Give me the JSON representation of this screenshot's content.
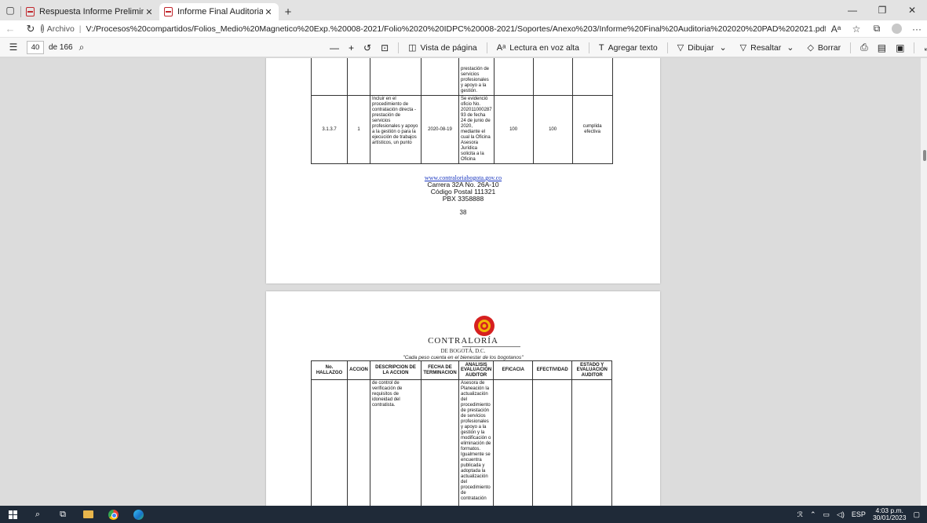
{
  "browser": {
    "tabs": [
      {
        "title": "Respuesta Informe Preliminar.pd",
        "active": false
      },
      {
        "title": "Informe Final Auditoria 2020 PAD",
        "active": true
      }
    ],
    "address": {
      "label": "Archivo",
      "url": "V:/Procesos%20compartidos/Folios_Medio%20Magnetico%20Exp.%20008-2021/Folio%2020%20IDPC%20008-2021/Soportes/Anexo%203/Informe%20Final%20Auditoria%202020%20PAD%202021.pdf"
    }
  },
  "pdf_toolbar": {
    "page_current": "40",
    "page_total": "de 166",
    "tools": {
      "zoom_out": "—",
      "zoom_in": "+",
      "page_view": "Vista de página",
      "read_aloud": "Lectura en voz alta",
      "add_text": "Agregar texto",
      "draw": "Dibujar",
      "highlight": "Resaltar",
      "erase": "Borrar"
    }
  },
  "page1": {
    "cont_row": {
      "analysis": "prestación de servicios profesionales y apoyo a la gestión."
    },
    "row": {
      "hallazgo": "3.1.3.7",
      "accion": "1",
      "descripcion": "Incluir en el procedimiento de contratación directa - prestación de servicios profesionales y apoyo a la gestión o para la ejecución de trabajos artísticos, un punto",
      "fecha": "2020-08-19",
      "analisis": "Se evidenció oficio No. 202011000287 93 de fecha 24 de junio de 2020, mediante el cual la Oficina Asesora Jurídica solicita a la Oficina",
      "eficacia": "100",
      "efectividad": "100",
      "estado": "cumplida efectiva"
    },
    "footer": {
      "website": "www.contraloriabogota.gov.co",
      "address": "Carrera 32A No. 26A-10",
      "postal": "Código Postal 111321",
      "phone": "PBX 3358888",
      "page_number": "38"
    }
  },
  "page2": {
    "logo": {
      "name": "CONTRALORÍA",
      "sub": "DE BOGOTÁ, D.C.",
      "motto": "\"Cada peso cuenta en el bienestar de los bogotanos\""
    },
    "headers": {
      "hallazgo": "No. HALLAZGO",
      "accion": "ACCION",
      "descripcion": "DESCRIPCION DE LA ACCION",
      "fecha": "FECHA DE TERMINACION",
      "analisis": "ANALISIS EVALUACIÓN AUDITOR",
      "eficacia": "EFICACIA",
      "efectividad": "EFECTIVIDAD",
      "estado": "ESTADO Y EVALUACIÓN AUDITOR"
    },
    "row": {
      "descripcion": "de control de verificación de requisitos de idoneidad del contratista.",
      "analisis": "Asesora de Planeación la actualización del procedimiento de prestación de servicios profesionales y apoyo a la gestión y la modificación o eliminación de formatos. Igualmente se encuentra publicada y adoptada la actualización del procedimiento de contratación"
    }
  },
  "taskbar": {
    "lang": "ESP",
    "time": "4:03 p.m.",
    "date": "30/01/2023"
  }
}
